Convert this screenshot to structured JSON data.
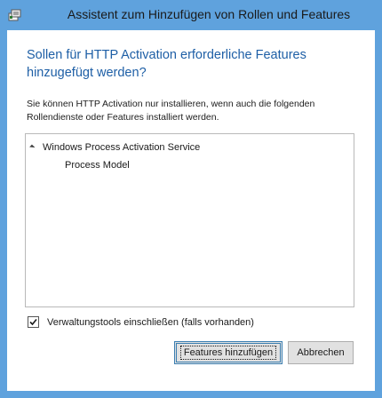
{
  "window": {
    "title": "Assistent zum Hinzufügen von Rollen und Features",
    "icon": "server-manager-icon",
    "frame_color": "#5fa2dd"
  },
  "dialog": {
    "heading": "Sollen für HTTP Activation erforderliche Features hinzugefügt werden?",
    "description": "Sie können HTTP Activation nur installieren, wenn auch die folgenden Rollendienste oder Features installiert werden.",
    "heading_color": "#1e5fa6"
  },
  "tree": {
    "root": "Windows Process Activation Service",
    "child": "Process Model",
    "expander_icon": "expanded-triangle-icon"
  },
  "options": {
    "include_tools_label": "Verwaltungstools einschließen (falls vorhanden)",
    "include_tools_checked": true
  },
  "buttons": {
    "add": "Features hinzufügen",
    "cancel": "Abbrechen"
  }
}
